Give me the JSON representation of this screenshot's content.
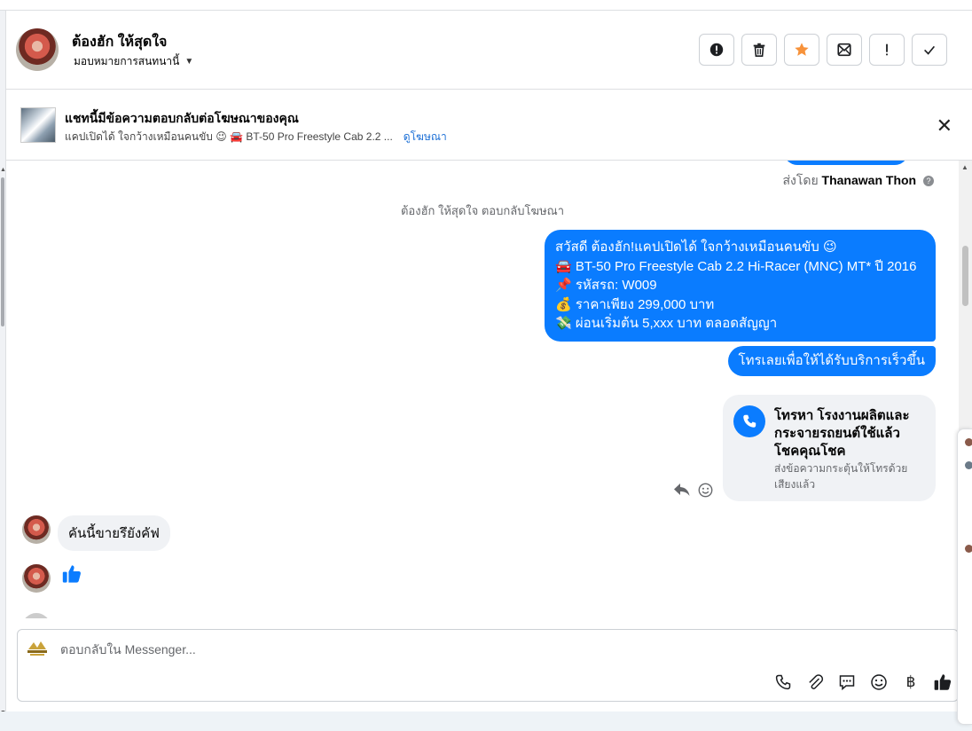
{
  "header": {
    "contact_name": "ต้องฮัก ให้สุดใจ",
    "assign_label": "มอบหมายการสนทนานี้",
    "actions": [
      {
        "name": "mark-spam-button",
        "icon": "alert-circle-icon"
      },
      {
        "name": "delete-button",
        "icon": "trash-icon"
      },
      {
        "name": "star-button",
        "icon": "star-icon",
        "color": "#f7923a"
      },
      {
        "name": "mark-unread-button",
        "icon": "envelope-icon"
      },
      {
        "name": "follow-up-button",
        "icon": "exclamation-icon"
      },
      {
        "name": "mark-done-button",
        "icon": "check-icon"
      }
    ]
  },
  "ad_banner": {
    "title": "แชทนี้มีข้อความตอบกลับต่อโฆษณาของคุณ",
    "subtitle": "แคปเปิดได้ ใจกว้างเหมือนคนขับ 😉 🚘 BT-50 Pro Freestyle Cab 2.2 ...",
    "link_label": "ดูโฆษณา"
  },
  "chat": {
    "sent_by_prefix": "ส่งโดย",
    "sent_by_name": "Thanawan Thon",
    "system_note": "ต้องฮัก ให้สุดใจ ตอบกลับโฆษณา",
    "ad_message_lines": [
      "สวัสดี ต้องฮัก!แคปเปิดได้ ใจกว้างเหมือนคนขับ 😉",
      "🚘 BT-50 Pro Freestyle Cab 2.2 Hi-Racer (MNC) MT* ปี 2016",
      "📌 รหัสรถ: W009",
      "💰 ราคาเพียง 299,000 บาท",
      "💸 ผ่อนเริ่มต้น 5,xxx บาท ตลอดสัญญา"
    ],
    "call_prompt": "โทรเลยเพื่อให้ได้รับบริการเร็วขึ้น",
    "call_card": {
      "title": "โทรหา โรงงานผลิตและกระจายรถยนต์ใช้แล้ว โชคคุณโชค",
      "subtitle": "ส่งข้อความกระตุ้นให้โทรด้วยเสียงแล้ว"
    },
    "incoming_message": "คันนี้ขายรึยังคัฟ",
    "accent_color": "#0a7cff"
  },
  "composer": {
    "placeholder": "ตอบกลับใน Messenger...",
    "tools": [
      "phone-icon",
      "attachment-icon",
      "saved-reply-icon",
      "emoji-icon",
      "baht-icon",
      "thumbs-up-icon"
    ],
    "baht_glyph": "฿"
  }
}
